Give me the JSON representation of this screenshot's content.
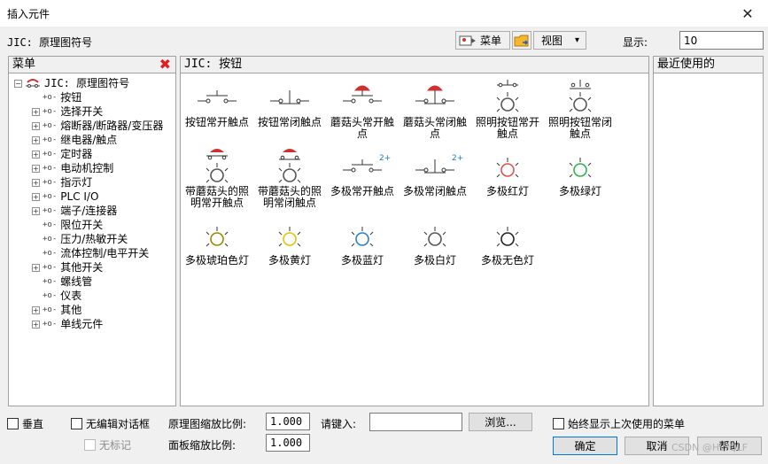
{
  "window": {
    "title": "插入元件",
    "close_glyph": "✕"
  },
  "top": {
    "library_label": "JIC: 原理图符号",
    "menu_button": "菜单",
    "view_button": "视图",
    "view_caret": "▾",
    "display_label": "显示:",
    "display_value": "10"
  },
  "menu_panel": {
    "title": "菜单",
    "root": "JIC: 原理图符号",
    "items": [
      {
        "label": "按钮",
        "expandable": false
      },
      {
        "label": "选择开关",
        "expandable": true
      },
      {
        "label": "熔断器/断路器/变压器",
        "expandable": true
      },
      {
        "label": "继电器/触点",
        "expandable": true
      },
      {
        "label": "定时器",
        "expandable": true
      },
      {
        "label": "电动机控制",
        "expandable": true
      },
      {
        "label": "指示灯",
        "expandable": true
      },
      {
        "label": "PLC I/O",
        "expandable": true
      },
      {
        "label": "端子/连接器",
        "expandable": true
      },
      {
        "label": "限位开关",
        "expandable": false
      },
      {
        "label": "压力/热敏开关",
        "expandable": false
      },
      {
        "label": "流体控制/电平开关",
        "expandable": false
      },
      {
        "label": "其他开关",
        "expandable": true
      },
      {
        "label": "螺线管",
        "expandable": false
      },
      {
        "label": "仪表",
        "expandable": false
      },
      {
        "label": "其他",
        "expandable": true
      },
      {
        "label": "单线元件",
        "expandable": true
      }
    ]
  },
  "symbols_panel": {
    "title": "JIC: 按钮",
    "items": [
      {
        "l1": "按钮常开触点",
        "l2": ""
      },
      {
        "l1": "按钮常闭触点",
        "l2": ""
      },
      {
        "l1": "蘑菇头常开触",
        "l2": "点"
      },
      {
        "l1": "蘑菇头常闭触",
        "l2": "点"
      },
      {
        "l1": "照明按钮常开",
        "l2": "触点"
      },
      {
        "l1": "照明按钮常闭",
        "l2": "触点"
      },
      {
        "l1": "带蘑菇头的照",
        "l2": "明常开触点"
      },
      {
        "l1": "带蘑菇头的照",
        "l2": "明常闭触点"
      },
      {
        "l1": "多极常开触点",
        "l2": "",
        "badge": "2+"
      },
      {
        "l1": "多极常闭触点",
        "l2": "",
        "badge": "2+"
      },
      {
        "l1": "多极红灯",
        "l2": ""
      },
      {
        "l1": "多极绿灯",
        "l2": ""
      },
      {
        "l1": "多极琥珀色灯",
        "l2": ""
      },
      {
        "l1": "多极黄灯",
        "l2": ""
      },
      {
        "l1": "多极蓝灯",
        "l2": ""
      },
      {
        "l1": "多极白灯",
        "l2": ""
      },
      {
        "l1": "多极无色灯",
        "l2": ""
      }
    ]
  },
  "recent_panel": {
    "title": "最近使用的"
  },
  "bottom": {
    "vertical": "垂直",
    "no_edit_dialog": "无编辑对话框",
    "no_tag": "无标记",
    "schematic_scale_label": "原理图缩放比例:",
    "schematic_scale_value": "1.000",
    "panel_scale_label": "面板缩放比例:",
    "panel_scale_value": "1.000",
    "please_input_label": "请键入:",
    "please_input_value": "",
    "browse_button": "浏览...",
    "always_show_last_menu": "始终显示上次使用的菜单",
    "ok_button": "确定",
    "cancel_button": "取消",
    "help_button": "帮助"
  },
  "watermark": "CSDN @HWQLF",
  "colors": {
    "red": "#e05050",
    "green": "#2db34a",
    "amber": "#9a8a00",
    "yellow": "#e8c000",
    "blue": "#2a7fd0",
    "white": "#555555",
    "none": "#222222",
    "badge": "#1a7fd4",
    "mushroom": "#d03030"
  }
}
